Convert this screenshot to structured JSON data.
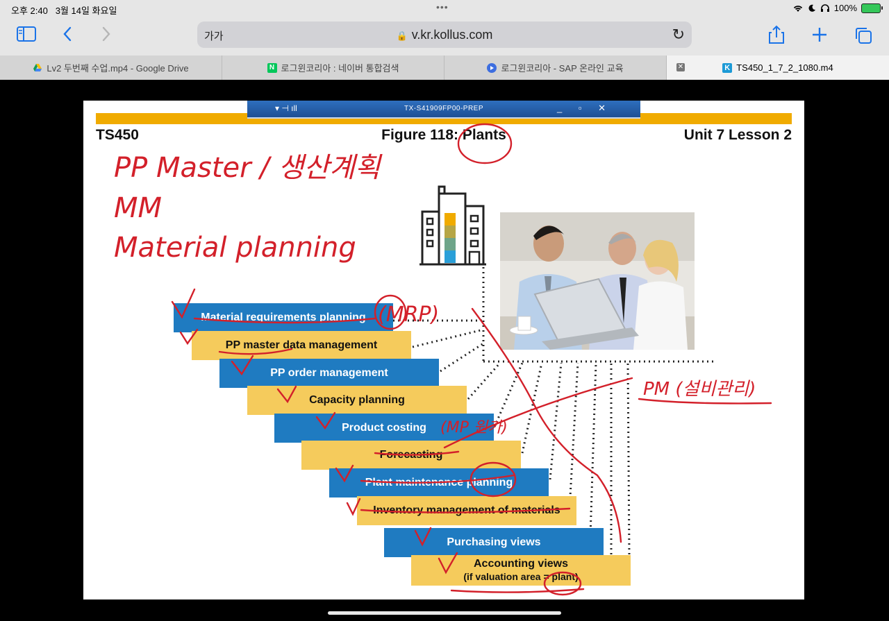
{
  "status_bar": {
    "time": "오후 2:40",
    "date": "3월 14일 화요일",
    "dots": "•••",
    "battery": "100%",
    "colors": {
      "battery": "#34c759"
    }
  },
  "toolbar": {
    "text_size_label": "가가",
    "url": "v.kr.kollus.com",
    "icons": [
      "sidebar-icon",
      "back-icon",
      "forward-icon",
      "lock-icon",
      "reload-icon",
      "share-icon",
      "new-tab-icon",
      "tabs-overview-icon"
    ],
    "accent": "#1a73e8"
  },
  "tabs": [
    {
      "title": "Lv2 두번째 수업.mp4 - Google Drive",
      "icon": "google-drive-icon",
      "active": false
    },
    {
      "title": "로그윈코리아 : 네이버 통합검색",
      "icon": "naver-icon",
      "active": false
    },
    {
      "title": "로그윈코리아 - SAP 온라인 교육",
      "icon": "play-icon",
      "active": false
    },
    {
      "title": "TS450_1_7_2_1080.m4",
      "icon": "kollus-icon",
      "active": true
    }
  ],
  "remote_bar": {
    "title": "TX-S41909FP00-PREP",
    "color": "#2e6fbe"
  },
  "slide": {
    "course": "TS450",
    "figure_title": "Figure 118: Plants",
    "unit": "Unit 7 Lesson 2",
    "accent_gold": "#f0ab00",
    "views": [
      {
        "label": "Material requirements planning",
        "color": "blue"
      },
      {
        "label": "PP master data management",
        "color": "gold"
      },
      {
        "label": "PP order management",
        "color": "blue"
      },
      {
        "label": "Capacity planning",
        "color": "gold"
      },
      {
        "label": "Product costing",
        "color": "blue"
      },
      {
        "label": "Forecasting",
        "color": "gold"
      },
      {
        "label": "Plant maintenance planning",
        "color": "blue"
      },
      {
        "label": "Inventory management of materials",
        "color": "gold"
      },
      {
        "label": "Purchasing views",
        "color": "blue"
      },
      {
        "label": "Accounting views",
        "sub": "(if valuation area = plant)",
        "color": "gold"
      }
    ],
    "images": [
      "building-icon",
      "business-meeting-photo"
    ]
  },
  "annotations": {
    "color": "#d3202a",
    "handwriting": [
      "PP Master / 생산계획",
      "MM",
      "Material planning",
      "(MRP)",
      "(MP 원가)",
      "PM (설비관리)"
    ]
  }
}
